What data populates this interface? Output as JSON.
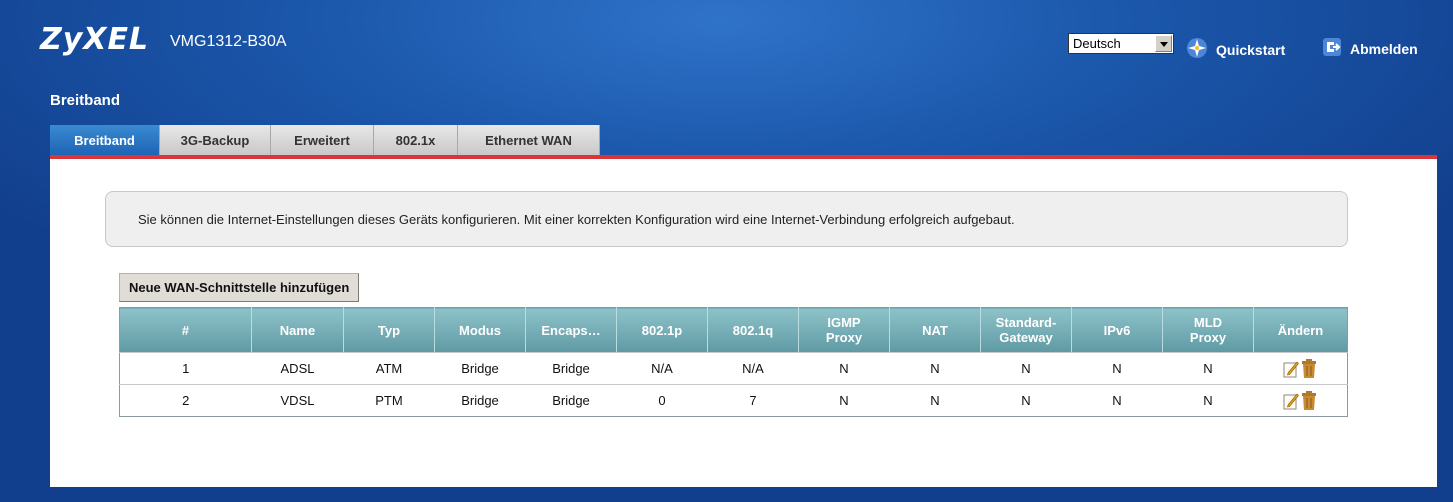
{
  "header": {
    "logo": "ZyXEL",
    "model": "VMG1312-B30A",
    "language_selected": "Deutsch",
    "quickstart_label": "Quickstart",
    "logout_label": "Abmelden"
  },
  "page": {
    "title": "Breitband",
    "tabs": [
      {
        "label": "Breitband",
        "active": true
      },
      {
        "label": "3G-Backup",
        "active": false
      },
      {
        "label": "Erweitert",
        "active": false
      },
      {
        "label": "802.1x",
        "active": false
      },
      {
        "label": "Ethernet WAN",
        "active": false
      }
    ],
    "info_text": "Sie können die Internet-Einstellungen dieses Geräts konfigurieren. Mit einer korrekten Konfiguration wird eine Internet-Verbindung erfolgreich aufgebaut.",
    "add_button_label": "Neue WAN-Schnittstelle hinzufügen"
  },
  "table": {
    "headers": [
      "#",
      "Name",
      "Typ",
      "Modus",
      "Encaps…",
      "802.1p",
      "802.1q",
      "IGMP Proxy",
      "NAT",
      "Standard-Gateway",
      "IPv6",
      "MLD Proxy",
      "Ändern"
    ],
    "header_lines": {
      "igmp": [
        "IGMP",
        "Proxy"
      ],
      "gateway": [
        "Standard-",
        "Gateway"
      ],
      "mld": [
        "MLD",
        "Proxy"
      ]
    },
    "rows": [
      [
        "1",
        "ADSL",
        "ATM",
        "Bridge",
        "Bridge",
        "N/A",
        "N/A",
        "N",
        "N",
        "N",
        "N",
        "N"
      ],
      [
        "2",
        "VDSL",
        "PTM",
        "Bridge",
        "Bridge",
        "0",
        "7",
        "N",
        "N",
        "N",
        "N",
        "N"
      ]
    ]
  },
  "icons": {
    "quickstart": "wizard-star-icon",
    "logout": "logout-icon",
    "edit": "edit-pencil-icon",
    "delete": "trash-can-icon"
  },
  "colors": {
    "background": "#14489a",
    "active_tab": "#1e64b5",
    "accent_line": "#d9353a",
    "table_header": "#5f9aa4"
  }
}
